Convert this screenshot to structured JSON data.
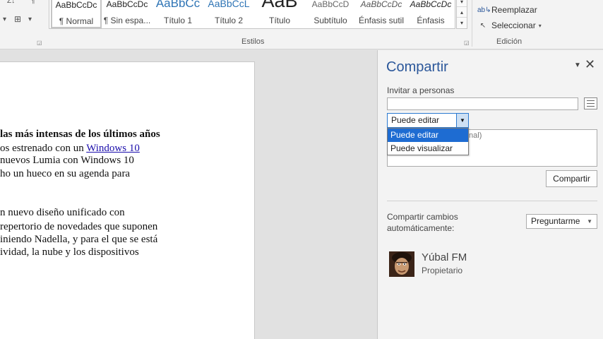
{
  "ribbon": {
    "styles_group_label": "Estilos",
    "edit_group_label": "Edición",
    "styles": [
      {
        "preview": "AaBbCcDc",
        "name": "¶ Normal",
        "color": "#222222",
        "size": "12px",
        "selected": true
      },
      {
        "preview": "AaBbCcDc",
        "name": "¶ Sin espa...",
        "color": "#222222",
        "size": "12px"
      },
      {
        "preview": "AaBbCc",
        "name": "Título 1",
        "color": "#2e74b5",
        "size": "17px"
      },
      {
        "preview": "AaBbCcL",
        "name": "Título 2",
        "color": "#2e74b5",
        "size": "14px"
      },
      {
        "preview": "AaB",
        "name": "Título",
        "color": "#222222",
        "size": "27px"
      },
      {
        "preview": "AaBbCcD",
        "name": "Subtítulo",
        "color": "#666666",
        "size": "12px"
      },
      {
        "preview": "AaBbCcDc",
        "name": "Énfasis sutil",
        "color": "#555555",
        "size": "12px",
        "italic": true
      },
      {
        "preview": "AaBbCcDc",
        "name": "Énfasis",
        "color": "#222222",
        "size": "12px",
        "italic": true
      }
    ],
    "replace_label": "Reemplazar",
    "select_label": "Seleccionar"
  },
  "document": {
    "lines": [
      "las más intensas de los últimos años",
      "os estrenado con un ",
      "Windows 10",
      "nuevos Lumia con Windows 10",
      "ho un hueco en su agenda para",
      "n nuevo diseño unificado con",
      "repertorio de novedades que suponen",
      "iniendo Nadella, y para el que se está",
      "ividad, la nube y los dispositivos"
    ]
  },
  "share_pane": {
    "title": "Compartir",
    "invite_label": "Invitar a personas",
    "invite_value": "",
    "permission_value": "Puede editar",
    "permission_options": [
      "Puede editar",
      "Puede visualizar"
    ],
    "message_placeholder": "cional)",
    "share_button": "Compartir",
    "auto_share_label": "Compartir cambios automáticamente:",
    "auto_share_value": "Preguntarme",
    "user": {
      "name": "Yúbal FM",
      "role": "Propietario"
    },
    "accent_color": "#2b579a"
  }
}
